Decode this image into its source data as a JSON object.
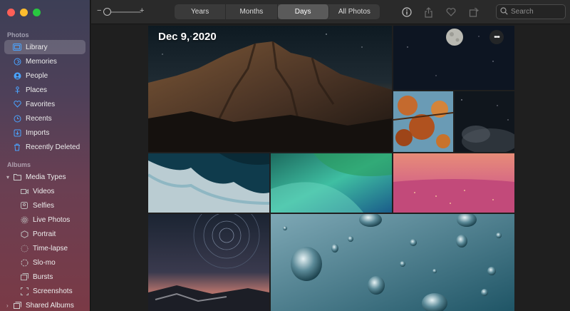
{
  "window": {
    "controls": [
      "close",
      "minimize",
      "zoom"
    ]
  },
  "sidebar": {
    "sections": [
      {
        "label": "Photos"
      },
      {
        "label": "Albums"
      }
    ],
    "photos_items": [
      {
        "label": "Library",
        "icon": "library-icon",
        "active": true
      },
      {
        "label": "Memories",
        "icon": "memories-icon"
      },
      {
        "label": "People",
        "icon": "people-icon"
      },
      {
        "label": "Places",
        "icon": "places-icon"
      },
      {
        "label": "Favorites",
        "icon": "heart-icon"
      },
      {
        "label": "Recents",
        "icon": "clock-icon"
      },
      {
        "label": "Imports",
        "icon": "imports-icon"
      },
      {
        "label": "Recently Deleted",
        "icon": "trash-icon"
      }
    ],
    "album_items": [
      {
        "label": "Media Types",
        "icon": "folder-icon",
        "expandable": true
      },
      {
        "label": "Videos",
        "icon": "video-icon"
      },
      {
        "label": "Selfies",
        "icon": "selfie-icon"
      },
      {
        "label": "Live Photos",
        "icon": "live-photo-icon"
      },
      {
        "label": "Portrait",
        "icon": "portrait-icon"
      },
      {
        "label": "Time-lapse",
        "icon": "timelapse-icon"
      },
      {
        "label": "Slo-mo",
        "icon": "slomo-icon"
      },
      {
        "label": "Bursts",
        "icon": "bursts-icon"
      },
      {
        "label": "Screenshots",
        "icon": "screenshot-icon"
      },
      {
        "label": "Shared Albums",
        "icon": "shared-albums-icon",
        "expandable": true
      }
    ]
  },
  "toolbar": {
    "zoom_minus": "−",
    "zoom_plus": "+",
    "tabs": [
      {
        "label": "Years"
      },
      {
        "label": "Months"
      },
      {
        "label": "Days",
        "active": true
      },
      {
        "label": "All Photos"
      }
    ],
    "search_placeholder": "Search"
  },
  "content": {
    "date_title": "Dec 9, 2020",
    "more_label": "•••"
  },
  "colors": {
    "accent": "#4aa3ff",
    "selected_tab": "#5a5a5a"
  }
}
